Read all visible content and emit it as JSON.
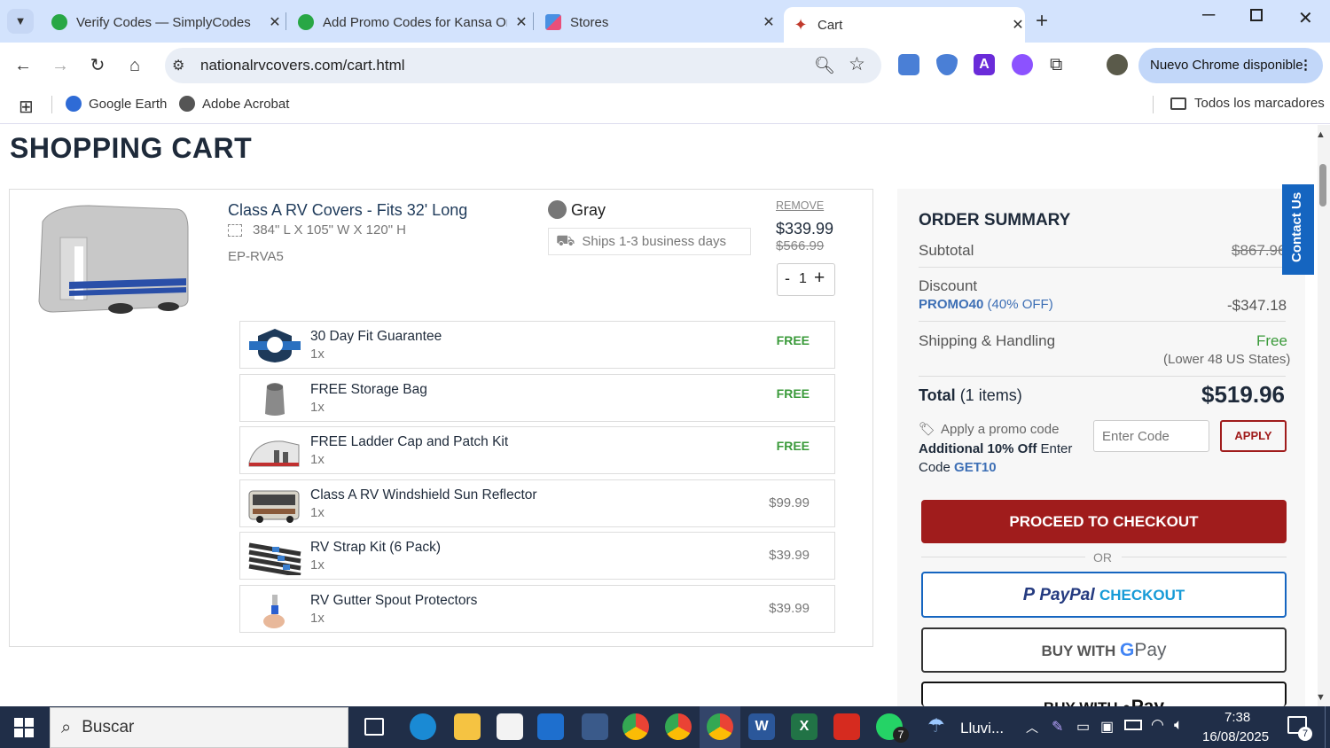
{
  "browser": {
    "tabs": [
      {
        "title": "Verify Codes — SimplyCodes",
        "icon": "simplycodes-icon"
      },
      {
        "title": "Add Promo Codes for Kansa Or",
        "icon": "simplycodes-icon"
      },
      {
        "title": "Stores",
        "icon": "stores-icon"
      },
      {
        "title": "Cart",
        "icon": "cart-icon"
      }
    ],
    "url": "nationalrvcovers.com/cart.html",
    "new_chrome": "Nuevo Chrome disponible",
    "bookmarks": [
      {
        "label": "Google Earth"
      },
      {
        "label": "Adobe Acrobat"
      }
    ],
    "all_bookmarks": "Todos los marcadores"
  },
  "cart": {
    "title": "SHOPPING CART",
    "product": {
      "name": "Class A RV Covers - Fits 32' Long",
      "dims": "384\" L X 105\" W X 120\" H",
      "sku": "EP-RVA5",
      "color": "Gray",
      "color_hex": "#777777",
      "shipping": "Ships 1-3 business days",
      "remove": "REMOVE",
      "price": "$339.99",
      "old_price": "$566.99",
      "qty_minus": "-",
      "qty": "1",
      "qty_plus": "+"
    },
    "addons": [
      {
        "name": "30 Day Fit Guarantee",
        "qty": "1x",
        "price": "FREE"
      },
      {
        "name": "FREE Storage Bag",
        "qty": "1x",
        "price": "FREE"
      },
      {
        "name": "FREE Ladder Cap and Patch Kit",
        "qty": "1x",
        "price": "FREE"
      },
      {
        "name": "Class A RV Windshield Sun Reflector",
        "qty": "1x",
        "price": "$99.99"
      },
      {
        "name": "RV Strap Kit (6 Pack)",
        "qty": "1x",
        "price": "$39.99"
      },
      {
        "name": "RV Gutter Spout Protectors",
        "qty": "1x",
        "price": "$39.99"
      }
    ]
  },
  "summary": {
    "title": "ORDER SUMMARY",
    "subtotal_label": "Subtotal",
    "subtotal_value": "$867.96",
    "discount_label": "Discount",
    "discount_code": "PROMO40",
    "discount_pct": "(40% OFF)",
    "discount_value": "-$347.18",
    "shipping_label": "Shipping & Handling",
    "shipping_value": "Free",
    "shipping_note": "(Lower 48 US States)",
    "total_label": "Total",
    "total_items": "(1 items)",
    "total_value": "$519.96",
    "promo_apply_label": "Apply a promo code",
    "promo_extra_bold": "Additional 10% Off",
    "promo_extra_text": "Enter",
    "promo_extra_text2": "Code",
    "promo_extra_code": "GET10",
    "code_placeholder": "Enter Code",
    "apply_button": "APPLY",
    "checkout_button": "PROCEED TO CHECKOUT",
    "or": "OR",
    "paypal_text": "PayPal",
    "paypal_checkout": "CHECKOUT",
    "gpay_buy": "BUY WITH",
    "gpay_g": "G",
    "gpay_pay": "Pay",
    "applepay_buy": "BUY WITH",
    "applepay_pay": "Pay",
    "contact": "Contact Us"
  },
  "taskbar": {
    "search": "Buscar",
    "weather": "Lluvi...",
    "time": "7:38",
    "date": "16/08/2025",
    "whatsapp_badge": "7",
    "notif_badge": "7"
  },
  "colors": {
    "accent_red": "#a01c1c",
    "promo_blue": "#3d6fb5",
    "free_green": "#3a9a3a"
  }
}
